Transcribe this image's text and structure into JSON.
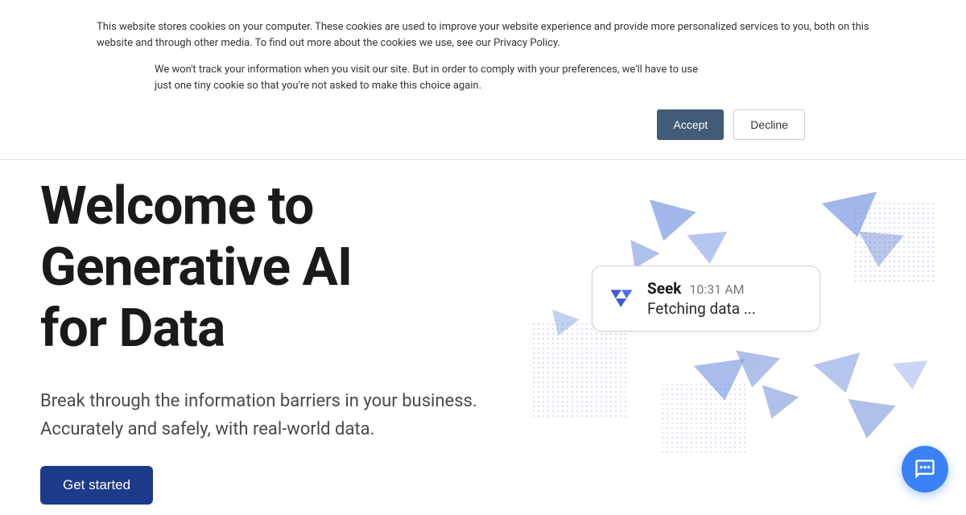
{
  "cookie_banner": {
    "text_1": "This website stores cookies on your computer. These cookies are used to improve your website experience and provide more personalized services to you, both on this website and through other media. To find out more about the cookies we use, see our Privacy Policy.",
    "text_2": "We won't track your information when you visit our site. But in order to comply with your preferences, we'll have to use just one tiny cookie so that you're not asked to make this choice again.",
    "accept_label": "Accept",
    "decline_label": "Decline"
  },
  "hero": {
    "title_line1": "Welcome to",
    "title_line2": "Generative AI",
    "title_line3": "for Data",
    "subtitle_line1": "Break through the information barriers in your business.",
    "subtitle_line2": "Accurately and safely, with real-world data.",
    "cta_label": "Get started"
  },
  "notification": {
    "app_name": "Seek",
    "timestamp": "10:31 AM",
    "status": "Fetching data ..."
  }
}
